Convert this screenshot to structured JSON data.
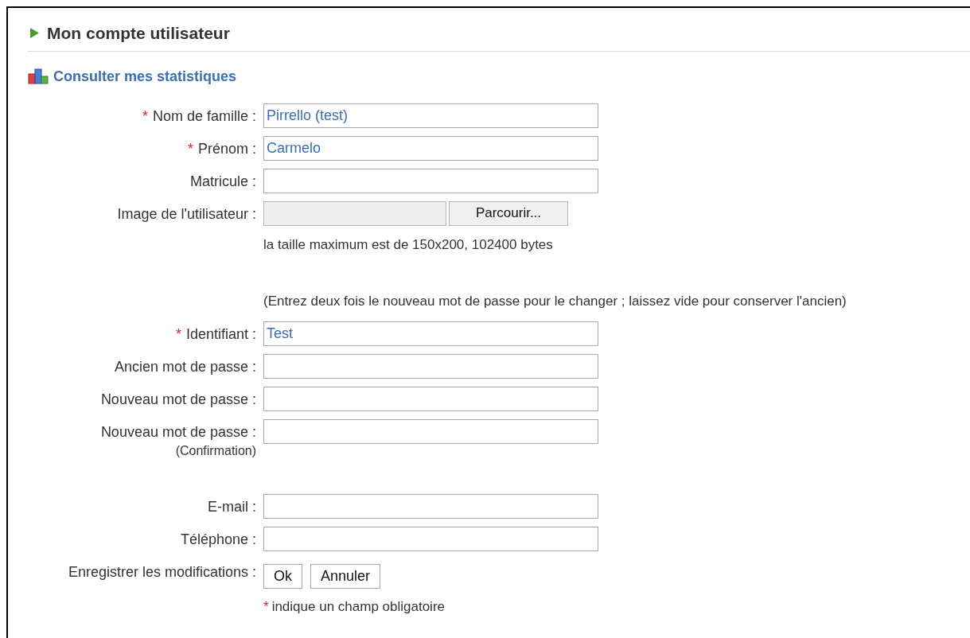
{
  "title": "Mon compte utilisateur",
  "stats_link": "Consulter mes statistiques",
  "groups": [
    [
      {
        "kind": "text",
        "required_mark": "*",
        "label": "Nom de famille :",
        "value": "Pirrello (test)"
      },
      {
        "kind": "text",
        "required_mark": "*",
        "label": "Prénom :",
        "value": "Carmelo"
      },
      {
        "kind": "text",
        "label": "Matricule :"
      },
      {
        "kind": "file",
        "label": "Image de l'utilisateur :",
        "button": "Parcourir..."
      },
      {
        "kind": "note",
        "text": "la taille maximum est de 150x200, 102400 bytes"
      }
    ],
    [
      {
        "kind": "note",
        "text": "(Entrez deux fois le nouveau mot de passe pour le changer ; laissez vide pour conserver l'ancien)"
      },
      {
        "kind": "text",
        "required_mark": "*",
        "label": "Identifiant :",
        "value": "Test"
      },
      {
        "kind": "text",
        "label": "Ancien mot de passe :"
      },
      {
        "kind": "text",
        "label": "Nouveau mot de passe :"
      },
      {
        "kind": "text",
        "label": "Nouveau mot de passe :",
        "sublabel": "(Confirmation)"
      }
    ],
    [
      {
        "kind": "text",
        "label": "E-mail :"
      },
      {
        "kind": "text",
        "label": "Téléphone :"
      },
      {
        "kind": "buttons",
        "label": "Enregistrer les modifications :",
        "buttons": [
          "Ok",
          "Annuler"
        ]
      },
      {
        "kind": "footnote",
        "mark": "*",
        "text": "indique un champ obligatoire"
      }
    ]
  ]
}
